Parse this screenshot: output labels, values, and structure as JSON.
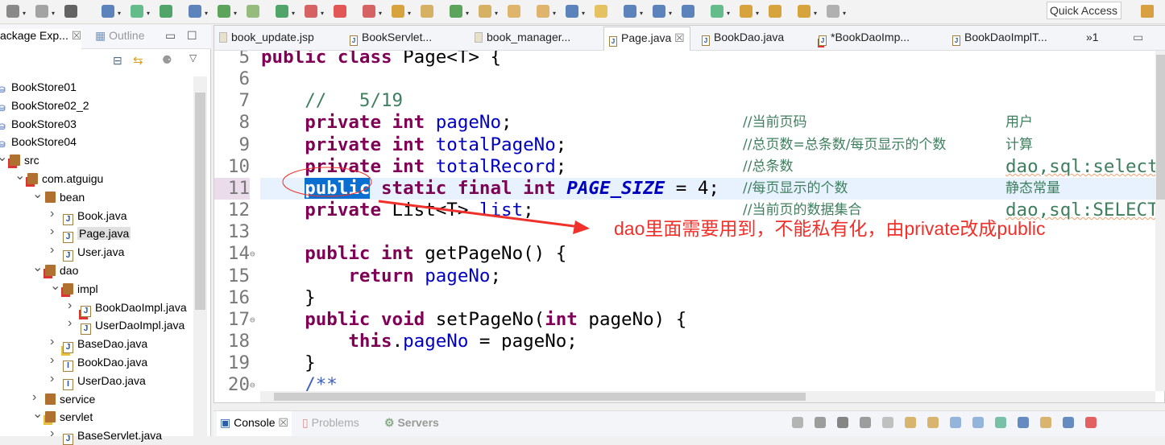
{
  "toolbar": {
    "quick_access": "Quick Access",
    "icon_colors": [
      "#666",
      "#888",
      "#333",
      "#2a5ea8",
      "#3a6",
      "#1b8a3c",
      "#2a5ea8",
      "#2a8a2a",
      "#7a5",
      "#1b8a3c",
      "#c33",
      "#d22",
      "#c33",
      "#c80",
      "#c93",
      "#2a8a2a",
      "#c93",
      "#d8a040",
      "#d8a040",
      "#2a5ea8",
      "#e0b030",
      "#2a5ea8",
      "#2a5ea8",
      "#2a5ea8",
      "#3a6",
      "#c80",
      "#c80",
      "#c80",
      "#999"
    ]
  },
  "left_panel": {
    "tabs": [
      {
        "label": "ackage Exp..."
      },
      {
        "label": "Outline"
      }
    ],
    "tree": [
      {
        "label": "BookStore01",
        "icon": "project-icon",
        "depth": 0
      },
      {
        "label": "BookStore02_2",
        "icon": "project-icon",
        "depth": 0
      },
      {
        "label": "BookStore03",
        "icon": "project-icon",
        "depth": 0
      },
      {
        "label": "BookStore04",
        "icon": "project-icon",
        "depth": 0
      },
      {
        "label": "src",
        "icon": "source-folder-error-icon",
        "depth": 1,
        "expanded": true
      },
      {
        "label": "com.atguigu",
        "icon": "package-error-icon",
        "depth": 2,
        "expanded": true
      },
      {
        "label": "bean",
        "icon": "package-icon",
        "depth": 3,
        "expanded": true
      },
      {
        "label": "Book.java",
        "icon": "java-file-icon",
        "depth": 4
      },
      {
        "label": "Page.java",
        "icon": "java-file-icon",
        "depth": 4,
        "selected": true
      },
      {
        "label": "User.java",
        "icon": "java-file-icon",
        "depth": 4
      },
      {
        "label": "dao",
        "icon": "package-error-icon",
        "depth": 3,
        "expanded": true
      },
      {
        "label": "impl",
        "icon": "package-error-icon",
        "depth": 4,
        "expanded": true
      },
      {
        "label": "BookDaoImpl.java",
        "icon": "java-file-error-icon",
        "depth": 5
      },
      {
        "label": "UserDaoImpl.java",
        "icon": "java-file-icon",
        "depth": 5
      },
      {
        "label": "BaseDao.java",
        "icon": "java-file-warning-icon",
        "depth": 4
      },
      {
        "label": "BookDao.java",
        "icon": "java-interface-icon",
        "depth": 4
      },
      {
        "label": "UserDao.java",
        "icon": "java-interface-icon",
        "depth": 4
      },
      {
        "label": "service",
        "icon": "package-icon",
        "depth": 3
      },
      {
        "label": "servlet",
        "icon": "package-warning-icon",
        "depth": 3,
        "expanded": true
      },
      {
        "label": "BaseServlet.java",
        "icon": "java-file-icon",
        "depth": 4
      }
    ]
  },
  "editor": {
    "tabs": [
      {
        "label": "book_update.jsp",
        "icon": "jsp-file-icon"
      },
      {
        "label": "BookServlet...",
        "icon": "java-file-icon"
      },
      {
        "label": "book_manager...",
        "icon": "jsp-file-icon"
      },
      {
        "label": "Page.java",
        "icon": "java-file-icon",
        "active": true
      },
      {
        "label": "BookDao.java",
        "icon": "java-file-icon"
      },
      {
        "label": "*BookDaoImp...",
        "icon": "java-file-error-icon"
      },
      {
        "label": "BookDaoImplT...",
        "icon": "java-file-icon"
      },
      {
        "label": "»1",
        "icon": "more-tabs-icon"
      }
    ],
    "lines": [
      {
        "no": "5",
        "tokens": [
          [
            "public",
            "kw"
          ],
          [
            " "
          ],
          [
            "class",
            "kw"
          ],
          [
            " Page<T> {"
          ]
        ]
      },
      {
        "no": "6",
        "tokens": []
      },
      {
        "no": "7",
        "tokens": [
          [
            "    "
          ],
          [
            "//   5/19",
            "co"
          ]
        ]
      },
      {
        "no": "8",
        "tokens": [
          [
            "    "
          ],
          [
            "private",
            "kw"
          ],
          [
            " "
          ],
          [
            "int",
            "kw"
          ],
          [
            " "
          ],
          [
            "pageNo",
            "fd"
          ],
          [
            ";"
          ]
        ],
        "comment": "//当前页码",
        "note": "用户"
      },
      {
        "no": "9",
        "tokens": [
          [
            "    "
          ],
          [
            "private",
            "kw"
          ],
          [
            " "
          ],
          [
            "int",
            "kw"
          ],
          [
            " "
          ],
          [
            "totalPageNo",
            "fd"
          ],
          [
            ";"
          ]
        ],
        "comment": "//总页数=总条数/每页显示的个数",
        "note": "计算"
      },
      {
        "no": "10",
        "tokens": [
          [
            "    "
          ],
          [
            "private",
            "kw"
          ],
          [
            " "
          ],
          [
            "int",
            "kw"
          ],
          [
            " "
          ],
          [
            "totalRecord",
            "fd"
          ],
          [
            ";"
          ]
        ],
        "comment": "//总条数",
        "note": "dao,sql:select",
        "note_mono": true
      },
      {
        "no": "11",
        "tokens": [
          [
            "    "
          ],
          [
            "public",
            "kw sel"
          ],
          [
            " "
          ],
          [
            "static",
            "kw"
          ],
          [
            " "
          ],
          [
            "final",
            "kw"
          ],
          [
            " "
          ],
          [
            "int",
            "kw"
          ],
          [
            " "
          ],
          [
            "PAGE_SIZE",
            "st"
          ],
          [
            " = 4;"
          ]
        ],
        "comment": "//每页显示的个数",
        "note": "静态常量",
        "current": true
      },
      {
        "no": "12",
        "tokens": [
          [
            "    "
          ],
          [
            "private",
            "kw"
          ],
          [
            " List<T> "
          ],
          [
            "list",
            "fd"
          ],
          [
            ";"
          ]
        ],
        "comment": "//当前页的数据集合",
        "note": "dao,sql:SELECT",
        "note_mono": true
      },
      {
        "no": "13",
        "tokens": []
      },
      {
        "no": "14",
        "tokens": [
          [
            "    "
          ],
          [
            "public",
            "kw"
          ],
          [
            " "
          ],
          [
            "int",
            "kw"
          ],
          [
            " getPageNo() {"
          ]
        ],
        "fold": true
      },
      {
        "no": "15",
        "tokens": [
          [
            "        "
          ],
          [
            "return",
            "kw"
          ],
          [
            " "
          ],
          [
            "pageNo",
            "fd"
          ],
          [
            ";"
          ]
        ]
      },
      {
        "no": "16",
        "tokens": [
          [
            "    }"
          ]
        ]
      },
      {
        "no": "17",
        "tokens": [
          [
            "    "
          ],
          [
            "public",
            "kw"
          ],
          [
            " "
          ],
          [
            "void",
            "kw"
          ],
          [
            " setPageNo("
          ],
          [
            "int",
            "kw"
          ],
          [
            " pageNo) {"
          ]
        ],
        "fold": true
      },
      {
        "no": "18",
        "tokens": [
          [
            "        "
          ],
          [
            "this",
            "kw"
          ],
          [
            "."
          ],
          [
            "pageNo",
            "fd"
          ],
          [
            " = pageNo;"
          ]
        ]
      },
      {
        "no": "19",
        "tokens": [
          [
            "    }"
          ]
        ]
      },
      {
        "no": "20",
        "tokens": [
          [
            "    "
          ],
          [
            "/**",
            "jd"
          ]
        ],
        "fold": true
      }
    ]
  },
  "annotation": {
    "text": "dao里面需要用到，不能私有化，由private改成public",
    "color": "#f0302a"
  },
  "bottom_panel": {
    "tabs": [
      {
        "label": "Console",
        "active": true
      },
      {
        "label": "Problems"
      },
      {
        "label": "Servers"
      }
    ]
  }
}
